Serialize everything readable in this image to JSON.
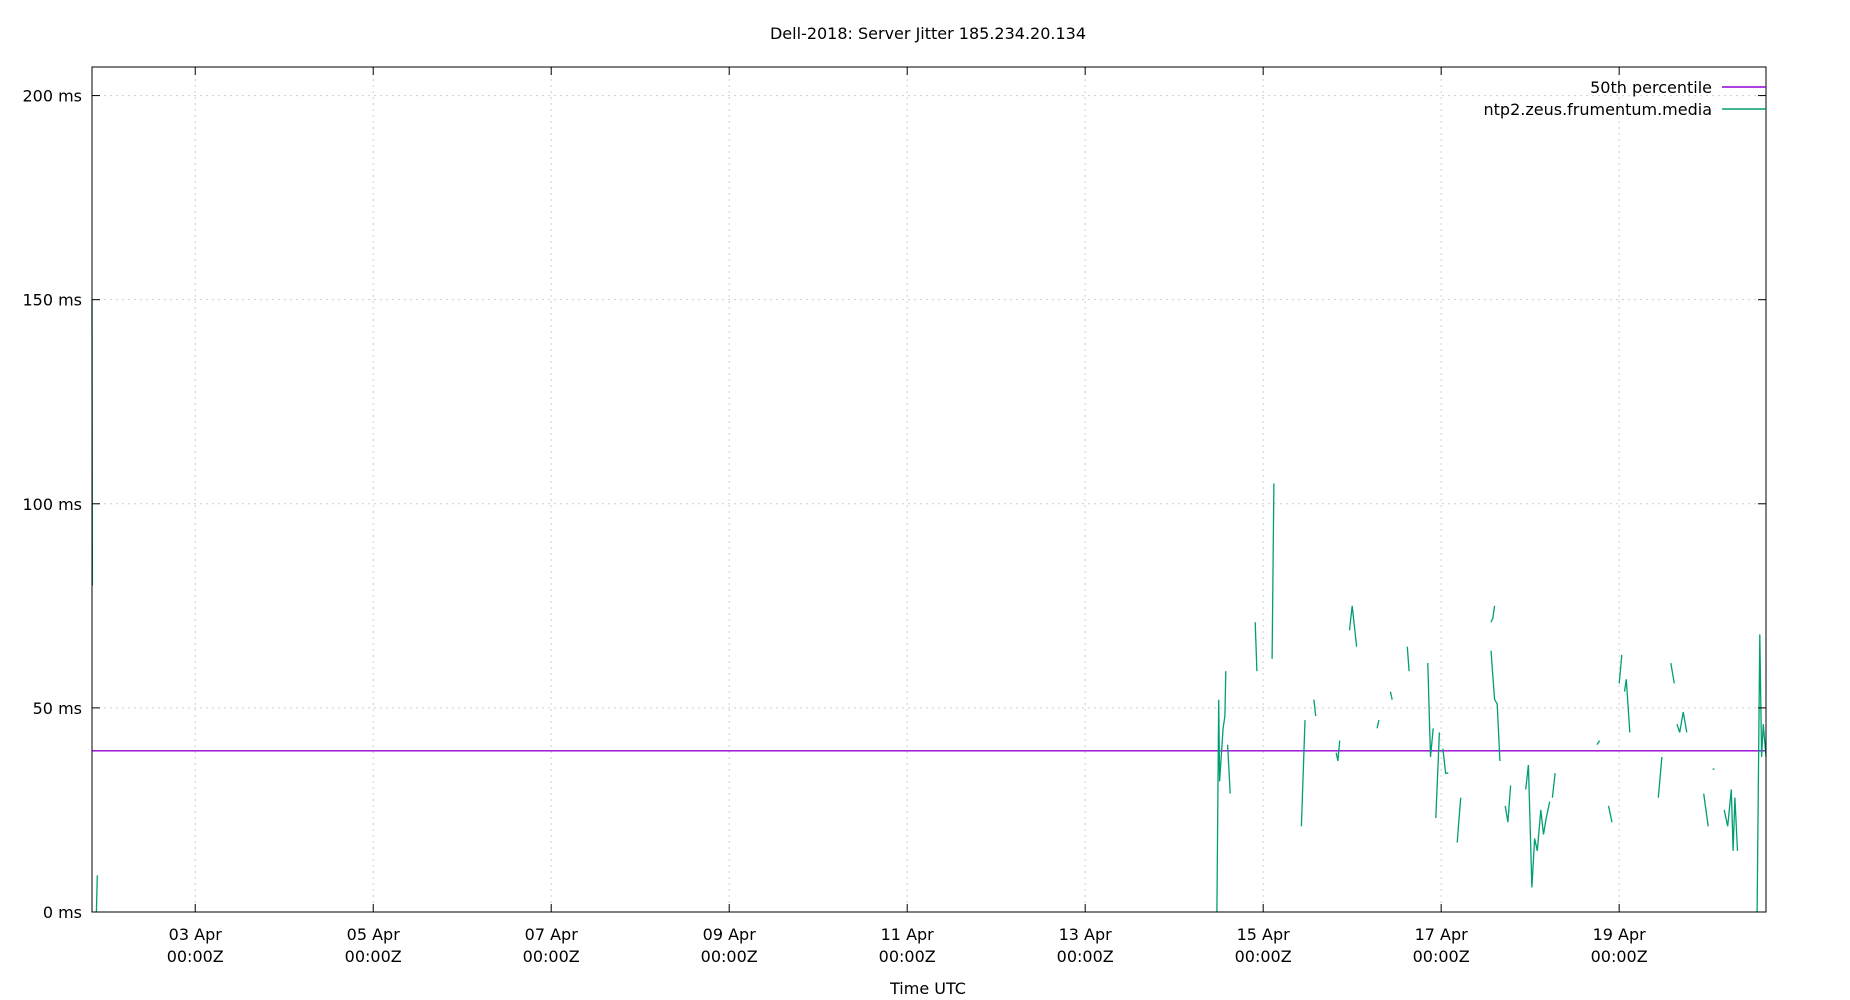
{
  "chart_data": {
    "type": "line",
    "title": "Dell-2018: Server Jitter 185.234.20.134",
    "xlabel": "Time UTC",
    "ylabel": "",
    "x_unit": "days since 01 Apr 00:00Z",
    "xlim": [
      0.84,
      19.65
    ],
    "ylim": [
      0,
      207
    ],
    "y_ticks": [
      {
        "value": 0,
        "label": "0 ms"
      },
      {
        "value": 50,
        "label": "50 ms"
      },
      {
        "value": 100,
        "label": "100 ms"
      },
      {
        "value": 150,
        "label": "150 ms"
      },
      {
        "value": 200,
        "label": "200 ms"
      }
    ],
    "x_ticks": [
      {
        "value": 2,
        "line1": "03 Apr",
        "line2": "00:00Z"
      },
      {
        "value": 4,
        "line1": "05 Apr",
        "line2": "00:00Z"
      },
      {
        "value": 6,
        "line1": "07 Apr",
        "line2": "00:00Z"
      },
      {
        "value": 8,
        "line1": "09 Apr",
        "line2": "00:00Z"
      },
      {
        "value": 10,
        "line1": "11 Apr",
        "line2": "00:00Z"
      },
      {
        "value": 12,
        "line1": "13 Apr",
        "line2": "00:00Z"
      },
      {
        "value": 14,
        "line1": "15 Apr",
        "line2": "00:00Z"
      },
      {
        "value": 16,
        "line1": "17 Apr",
        "line2": "00:00Z"
      },
      {
        "value": 18,
        "line1": "19 Apr",
        "line2": "00:00Z"
      }
    ],
    "grid": true,
    "legend_position": "top-right",
    "series": [
      {
        "name": "50th percentile",
        "color": "#9400d3",
        "segments": [
          [
            [
              0.84,
              39.5
            ],
            [
              19.65,
              39.5
            ]
          ]
        ]
      },
      {
        "name": "ntp2.zeus.frumentum.media",
        "color": "#009e73",
        "segments": [
          [
            [
              0.84,
              150
            ],
            [
              0.845,
              80
            ]
          ],
          [
            [
              0.89,
              0
            ],
            [
              0.9,
              9
            ]
          ],
          [
            [
              13.48,
              0
            ],
            [
              13.5,
              52
            ],
            [
              13.51,
              32
            ],
            [
              13.55,
              45
            ],
            [
              13.57,
              48
            ],
            [
              13.58,
              59
            ]
          ],
          [
            [
              13.6,
              41
            ],
            [
              13.63,
              29
            ]
          ],
          [
            [
              13.91,
              71
            ],
            [
              13.93,
              59
            ]
          ],
          [
            [
              14.1,
              62
            ],
            [
              14.12,
              105
            ]
          ],
          [
            [
              14.43,
              21
            ],
            [
              14.47,
              47
            ]
          ],
          [
            [
              14.57,
              52
            ],
            [
              14.59,
              48
            ]
          ],
          [
            [
              14.82,
              39
            ],
            [
              14.84,
              37
            ],
            [
              14.86,
              42
            ]
          ],
          [
            [
              14.97,
              69
            ],
            [
              15.0,
              75
            ],
            [
              15.05,
              65
            ]
          ],
          [
            [
              15.28,
              45
            ],
            [
              15.3,
              47
            ]
          ],
          [
            [
              15.43,
              54
            ],
            [
              15.45,
              52
            ]
          ],
          [
            [
              15.62,
              65
            ],
            [
              15.64,
              59
            ]
          ],
          [
            [
              15.85,
              61
            ],
            [
              15.88,
              38
            ],
            [
              15.91,
              45
            ]
          ],
          [
            [
              15.94,
              23
            ],
            [
              15.98,
              44
            ]
          ],
          [
            [
              16.02,
              40
            ],
            [
              16.05,
              34
            ],
            [
              16.08,
              34
            ]
          ],
          [
            [
              16.18,
              17
            ],
            [
              16.22,
              28
            ]
          ],
          [
            [
              16.56,
              71
            ],
            [
              16.58,
              72
            ],
            [
              16.6,
              75
            ]
          ],
          [
            [
              16.56,
              64
            ],
            [
              16.6,
              52
            ],
            [
              16.63,
              51
            ],
            [
              16.66,
              37
            ]
          ],
          [
            [
              16.72,
              26
            ],
            [
              16.75,
              22
            ],
            [
              16.78,
              31
            ]
          ],
          [
            [
              16.95,
              30
            ],
            [
              16.98,
              36
            ],
            [
              17.02,
              6
            ],
            [
              17.05,
              18
            ],
            [
              17.08,
              15
            ],
            [
              17.12,
              25
            ],
            [
              17.15,
              19
            ],
            [
              17.18,
              23
            ],
            [
              17.22,
              27
            ]
          ],
          [
            [
              17.25,
              28
            ],
            [
              17.28,
              34
            ]
          ],
          [
            [
              17.75,
              41
            ],
            [
              17.78,
              42
            ]
          ],
          [
            [
              17.88,
              26
            ],
            [
              17.92,
              22
            ]
          ],
          [
            [
              18.0,
              56
            ],
            [
              18.03,
              63
            ]
          ],
          [
            [
              18.06,
              54
            ],
            [
              18.08,
              57
            ],
            [
              18.12,
              44
            ]
          ],
          [
            [
              18.44,
              28
            ],
            [
              18.48,
              38
            ]
          ],
          [
            [
              18.58,
              61
            ],
            [
              18.62,
              56
            ]
          ],
          [
            [
              18.65,
              46
            ],
            [
              18.68,
              44
            ],
            [
              18.72,
              49
            ],
            [
              18.76,
              44
            ]
          ],
          [
            [
              18.95,
              29
            ],
            [
              19.0,
              21
            ]
          ],
          [
            [
              19.05,
              35
            ],
            [
              19.07,
              35
            ]
          ],
          [
            [
              19.18,
              25
            ],
            [
              19.22,
              21
            ],
            [
              19.26,
              30
            ],
            [
              19.28,
              15
            ],
            [
              19.3,
              28
            ],
            [
              19.33,
              15
            ]
          ],
          [
            [
              19.55,
              0
            ],
            [
              19.58,
              68
            ],
            [
              19.6,
              38
            ],
            [
              19.62,
              46
            ],
            [
              19.65,
              38
            ]
          ]
        ]
      }
    ]
  }
}
